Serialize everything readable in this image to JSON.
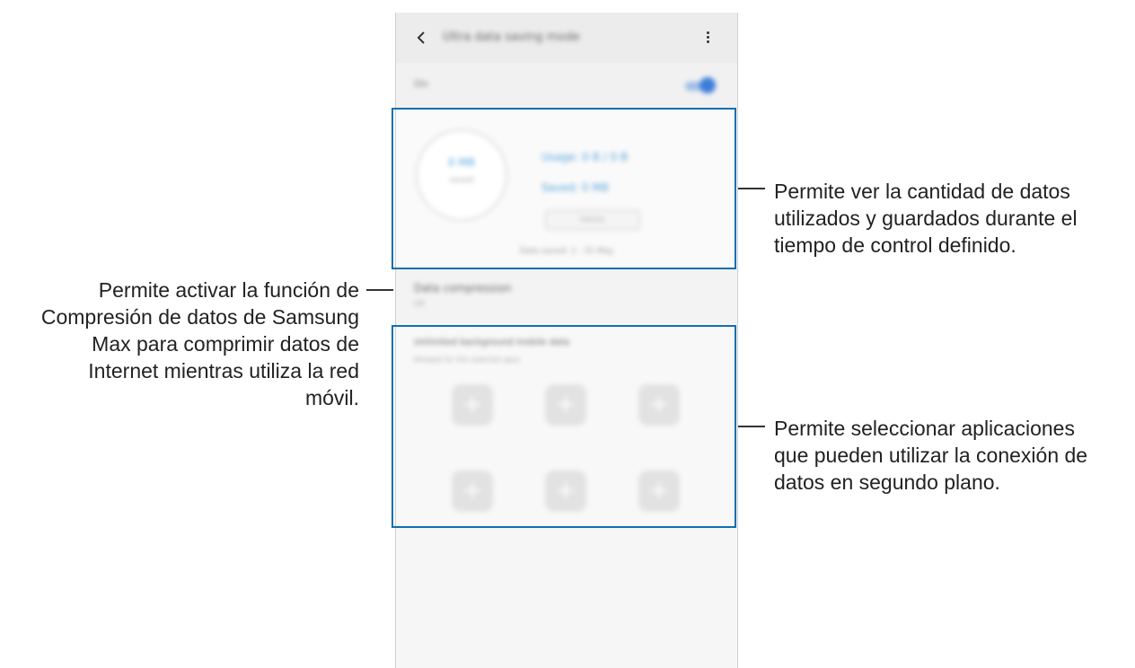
{
  "screen": {
    "title": "Ultra data saving mode",
    "on_label": "On",
    "usage": {
      "circle_value": "0 MB",
      "circle_unit": "saved",
      "used_label": "Usage: 0 B / 0 B",
      "saved_label": "Saved: 0 MB",
      "detail_button": "Details",
      "period": "Data saved: 1 - 31 May"
    },
    "compression": {
      "title": "Data compression",
      "subtitle": "Off"
    },
    "apps": {
      "title": "Unlimited background mobile data",
      "subtitle": "Allowed for the selected apps",
      "add_symbol": "+"
    }
  },
  "callouts": {
    "usage_lines": [
      "Permite ver la cantidad de datos",
      "utilizados y guardados durante el",
      "tiempo de control definido."
    ],
    "compression_lines": [
      "Permite activar la función de",
      "Compresión de datos de Samsung",
      "Max para comprimir datos de",
      "Internet mientras utiliza la red",
      "móvil."
    ],
    "apps_lines": [
      "Permite seleccionar aplicaciones",
      "que pueden utilizar la conexión de",
      "datos en segundo plano."
    ]
  },
  "colors": {
    "highlight": "#0f6fb0",
    "accent": "#3c7dd9"
  }
}
